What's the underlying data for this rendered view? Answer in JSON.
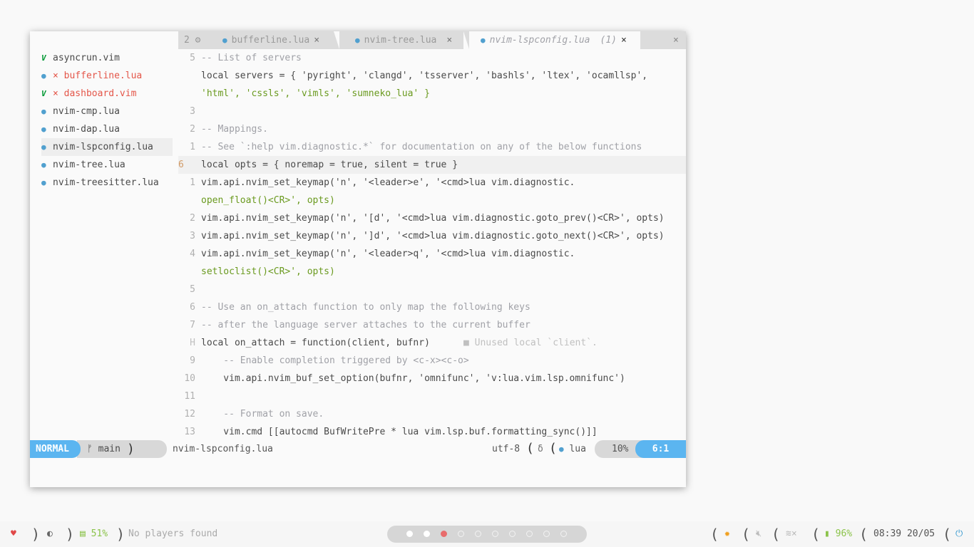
{
  "sidebar": {
    "files": [
      {
        "name": "asyncrun.vim",
        "icon": "vim-icon",
        "status": "ok"
      },
      {
        "name": "bufferline.lua",
        "icon": "lua-icon",
        "status": "error"
      },
      {
        "name": "dashboard.vim",
        "icon": "vim-icon",
        "status": "error"
      },
      {
        "name": "nvim-cmp.lua",
        "icon": "lua-icon",
        "status": "none"
      },
      {
        "name": "nvim-dap.lua",
        "icon": "lua-icon",
        "status": "none"
      },
      {
        "name": "nvim-lspconfig.lua",
        "icon": "lua-icon",
        "status": "active"
      },
      {
        "name": "nvim-tree.lua",
        "icon": "lua-icon",
        "status": "none"
      },
      {
        "name": "nvim-treesitter.lua",
        "icon": "lua-icon",
        "status": "none"
      }
    ]
  },
  "tabs": {
    "count_label": "2",
    "items": [
      {
        "name": "bufferline.lua",
        "close": "×"
      },
      {
        "name": "nvim-tree.lua",
        "close": "×"
      },
      {
        "name": "nvim-lspconfig.lua",
        "count": "(1)",
        "close": "×"
      }
    ],
    "close_all": "×"
  },
  "editor": {
    "lines": [
      {
        "n": "5",
        "text": "-- List of servers"
      },
      {
        "n": "",
        "text": "local servers = { 'pyright', 'clangd', 'tsserver', 'bashls', 'ltex', 'ocamllsp',"
      },
      {
        "n": "",
        "text": "'html', 'cssls', 'vimls', 'sumneko_lua' }"
      },
      {
        "n": "3",
        "text": ""
      },
      {
        "n": "2",
        "text": "-- Mappings."
      },
      {
        "n": "1",
        "text": "-- See `:help vim.diagnostic.*` for documentation on any of the below functions"
      },
      {
        "n": "6",
        "text": "local opts = { noremap = true, silent = true }"
      },
      {
        "n": "1",
        "text": "vim.api.nvim_set_keymap('n', '<leader>e', '<cmd>lua vim.diagnostic."
      },
      {
        "n": "",
        "text": "open_float()<CR>', opts)"
      },
      {
        "n": "2",
        "text": "vim.api.nvim_set_keymap('n', '[d', '<cmd>lua vim.diagnostic.goto_prev()<CR>', opts)"
      },
      {
        "n": "3",
        "text": "vim.api.nvim_set_keymap('n', ']d', '<cmd>lua vim.diagnostic.goto_next()<CR>', opts)"
      },
      {
        "n": "4",
        "text": "vim.api.nvim_set_keymap('n', '<leader>q', '<cmd>lua vim.diagnostic."
      },
      {
        "n": "",
        "text": "setloclist()<CR>', opts)"
      },
      {
        "n": "5",
        "text": ""
      },
      {
        "n": "6",
        "text": "-- Use an on_attach function to only map the following keys"
      },
      {
        "n": "7",
        "text": "-- after the language server attaches to the current buffer"
      },
      {
        "n": "H",
        "text": "local on_attach = function(client, bufnr)"
      },
      {
        "n": "9",
        "text": "    -- Enable completion triggered by <c-x><c-o>"
      },
      {
        "n": "10",
        "text": "    vim.api.nvim_buf_set_option(bufnr, 'omnifunc', 'v:lua.vim.lsp.omnifunc')"
      },
      {
        "n": "11",
        "text": ""
      },
      {
        "n": "12",
        "text": "    -- Format on save."
      },
      {
        "n": "13",
        "text": "    vim.cmd [[autocmd BufWritePre * lua vim.lsp.buf.formatting_sync()]]"
      }
    ],
    "diagnostic": "Unused local `client`."
  },
  "statusline": {
    "mode": "NORMAL",
    "branch_icon": "ᚠ",
    "branch": "main",
    "filename": "nvim-lspconfig.lua",
    "encoding": "utf-8",
    "os_icon": "δ",
    "filetype": "lua",
    "percent": "10%",
    "position": "6:1"
  },
  "bar": {
    "heart": "♥",
    "cpu_label": "51%",
    "player": "No players found",
    "workspaces": {
      "total": 10,
      "current": 2,
      "urgent": 3
    },
    "battery": "96%",
    "clock": "08:39 20/05"
  }
}
